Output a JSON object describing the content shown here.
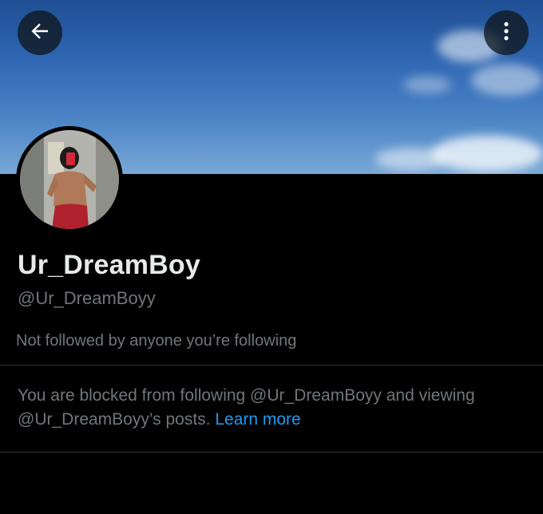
{
  "header": {
    "back_icon": "arrow-left-icon",
    "more_icon": "more-vertical-icon"
  },
  "profile": {
    "display_name": "Ur_DreamBoy",
    "handle": "@Ur_DreamBoyy",
    "followed_status": "Not followed by anyone you’re following"
  },
  "blocked_notice": {
    "text": "You are blocked from following @Ur_DreamBoyy and viewing @Ur_DreamBoyy’s posts.",
    "link_label": "Learn more"
  },
  "colors": {
    "background": "#000000",
    "primary_text": "#e7e9ea",
    "secondary_text": "#71767b",
    "link": "#1d9bf0",
    "divider": "#2f3336"
  }
}
